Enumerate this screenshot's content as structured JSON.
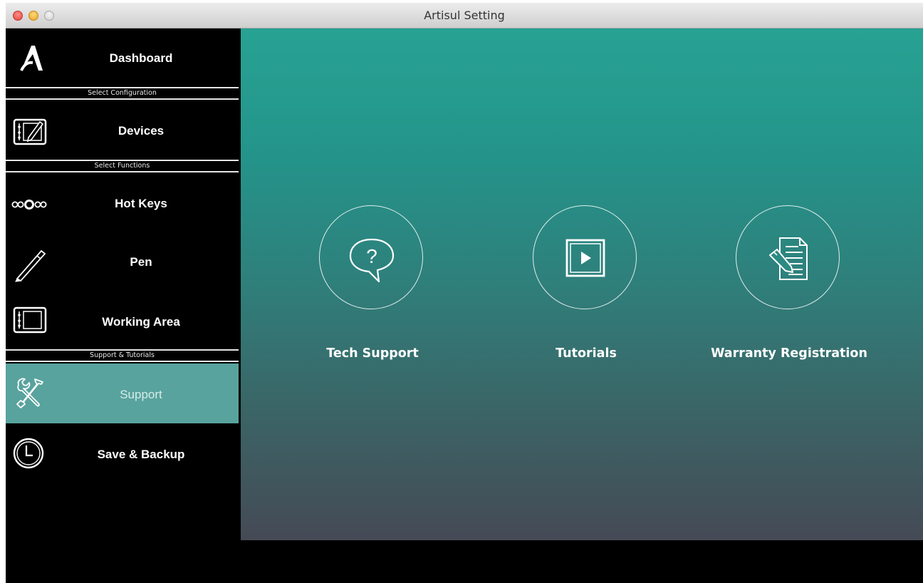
{
  "window": {
    "title": "Artisul Setting"
  },
  "sidebar": {
    "items": {
      "dashboard": {
        "label": "Dashboard",
        "icon": "artisul-logo-icon"
      },
      "devices": {
        "label": "Devices",
        "icon": "tablet-pen-icon"
      },
      "hot_keys": {
        "label": "Hot Keys",
        "icon": "hot-keys-icon"
      },
      "pen": {
        "label": "Pen",
        "icon": "pen-icon"
      },
      "working_area": {
        "label": "Working Area",
        "icon": "tablet-icon"
      },
      "support": {
        "label": "Support",
        "icon": "tools-icon",
        "active": true
      },
      "save_backup": {
        "label": "Save & Backup",
        "icon": "clock-icon"
      }
    },
    "sections": {
      "configuration": "Select Configuration",
      "functions": "Select Functions",
      "support": "Support & Tutorials"
    }
  },
  "main": {
    "tiles": {
      "tech_support": {
        "label": "Tech Support",
        "icon": "question-bubble-icon"
      },
      "tutorials": {
        "label": "Tutorials",
        "icon": "video-play-icon"
      },
      "warranty": {
        "label": "Warranty Registration",
        "icon": "document-edit-icon"
      }
    }
  },
  "colors": {
    "sidebar_bg": "#000000",
    "active_item": "#58a39e",
    "main_gradient_top": "#27a293",
    "main_gradient_bottom": "#454a55"
  }
}
